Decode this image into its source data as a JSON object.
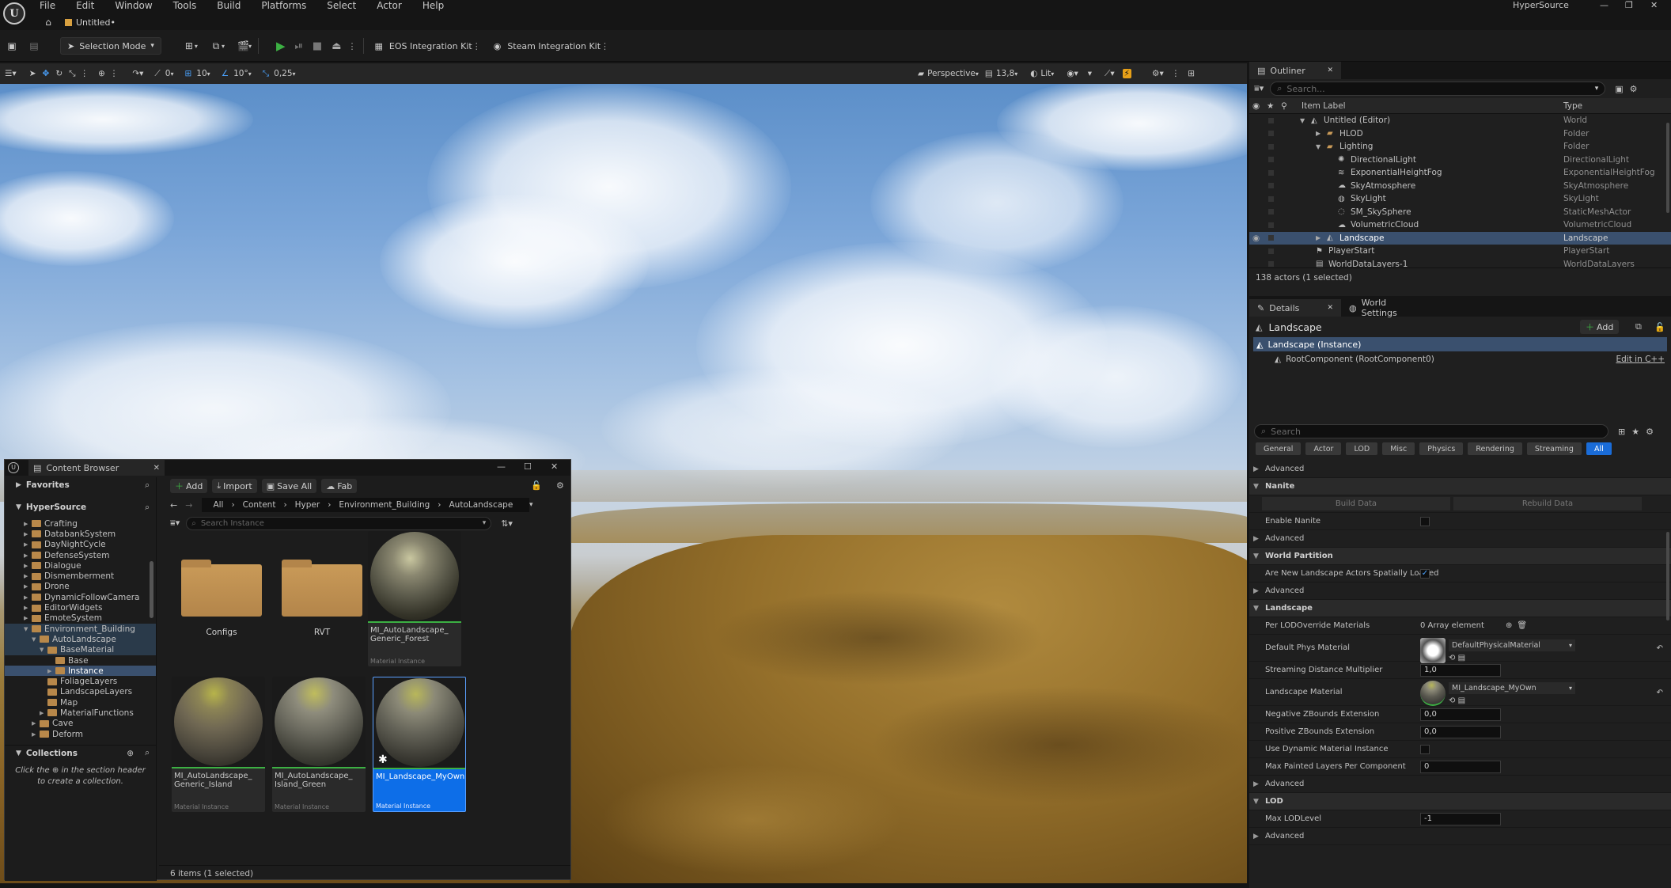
{
  "menubar": {
    "items": [
      "File",
      "Edit",
      "Window",
      "Tools",
      "Build",
      "Platforms",
      "Select",
      "Actor",
      "Help"
    ],
    "project_name": "HyperSource",
    "level_tab": "Untitled•"
  },
  "toolbar": {
    "selection_mode": "Selection Mode",
    "plugin1": "EOS Integration Kit",
    "plugin2": "Steam Integration Kit"
  },
  "viewport_toolbar": {
    "rot_snap": "0",
    "grid_snap": "10",
    "angle_snap": "10°",
    "scale_snap": "0,25",
    "perspective": "Perspective",
    "camera_speed": "13,8",
    "lit": "Lit"
  },
  "outliner": {
    "tab": "Outliner",
    "search_placeholder": "Search...",
    "col_label": "Item Label",
    "col_type": "Type",
    "rows": [
      {
        "label": "Untitled (Editor)",
        "type": "World"
      },
      {
        "label": "HLOD",
        "type": "Folder"
      },
      {
        "label": "Lighting",
        "type": "Folder"
      },
      {
        "label": "DirectionalLight",
        "type": "DirectionalLight"
      },
      {
        "label": "ExponentialHeightFog",
        "type": "ExponentialHeightFog"
      },
      {
        "label": "SkyAtmosphere",
        "type": "SkyAtmosphere"
      },
      {
        "label": "SkyLight",
        "type": "SkyLight"
      },
      {
        "label": "SM_SkySphere",
        "type": "StaticMeshActor"
      },
      {
        "label": "VolumetricCloud",
        "type": "VolumetricCloud"
      },
      {
        "label": "Landscape",
        "type": "Landscape"
      },
      {
        "label": "PlayerStart",
        "type": "PlayerStart"
      },
      {
        "label": "WorldDataLayers-1",
        "type": "WorldDataLayers"
      }
    ],
    "footer": "138 actors (1 selected)"
  },
  "details": {
    "tab_details": "Details",
    "tab_world": "World Settings",
    "actor_name": "Landscape",
    "add_label": "Add",
    "instance_label": "Landscape (Instance)",
    "root_component": "RootComponent (RootComponent0)",
    "edit_cpp": "Edit in C++",
    "search_placeholder": "Search",
    "filters": [
      "General",
      "Actor",
      "LOD",
      "Misc",
      "Physics",
      "Rendering",
      "Streaming",
      "All"
    ],
    "advanced": "Advanced",
    "nanite": "Nanite",
    "build_data": "Build Data",
    "rebuild_data": "Rebuild Data",
    "enable_nanite": "Enable Nanite",
    "world_partition": "World Partition",
    "spatially_loaded": "Are New Landscape Actors Spatially Loaded",
    "landscape_cat": "Landscape",
    "per_lod": "Per LODOverride Materials",
    "per_lod_val": "0 Array element",
    "default_phys": "Default Phys Material",
    "default_phys_val": "DefaultPhysicalMaterial",
    "streaming_dist": "Streaming Distance Multiplier",
    "streaming_dist_val": "1,0",
    "landscape_material": "Landscape Material",
    "landscape_material_val": "MI_Landscape_MyOwn",
    "neg_z": "Negative ZBounds Extension",
    "neg_z_val": "0,0",
    "pos_z": "Positive ZBounds Extension",
    "pos_z_val": "0,0",
    "use_dyn": "Use Dynamic Material Instance",
    "max_painted": "Max Painted Layers Per Component",
    "max_painted_val": "0",
    "lod_cat": "LOD",
    "max_lod": "Max LODLevel",
    "max_lod_val": "-1"
  },
  "content_browser": {
    "title": "Content Browser",
    "favorites": "Favorites",
    "root": "HyperSource",
    "add": "Add",
    "import": "Import",
    "save_all": "Save All",
    "fab": "Fab",
    "path": [
      "All",
      "Content",
      "Hyper",
      "Environment_Building",
      "AutoLandscape"
    ],
    "search_placeholder": "Search Instance",
    "tree": [
      {
        "label": "Crafting",
        "depth": 0
      },
      {
        "label": "DatabankSystem",
        "depth": 0
      },
      {
        "label": "DayNightCycle",
        "depth": 0
      },
      {
        "label": "DefenseSystem",
        "depth": 0
      },
      {
        "label": "Dialogue",
        "depth": 0
      },
      {
        "label": "Dismemberment",
        "depth": 0
      },
      {
        "label": "Drone",
        "depth": 0
      },
      {
        "label": "DynamicFollowCamera",
        "depth": 0
      },
      {
        "label": "EditorWidgets",
        "depth": 0
      },
      {
        "label": "EmoteSystem",
        "depth": 0
      },
      {
        "label": "Environment_Building",
        "depth": 0
      },
      {
        "label": "AutoLandscape",
        "depth": 1
      },
      {
        "label": "BaseMaterial",
        "depth": 2
      },
      {
        "label": "Base",
        "depth": 3
      },
      {
        "label": "Instance",
        "depth": 3
      },
      {
        "label": "FoliageLayers",
        "depth": 2
      },
      {
        "label": "LandscapeLayers",
        "depth": 2
      },
      {
        "label": "Map",
        "depth": 2
      },
      {
        "label": "MaterialFunctions",
        "depth": 2
      },
      {
        "label": "Cave",
        "depth": 1
      },
      {
        "label": "Deform",
        "depth": 1
      }
    ],
    "collections": "Collections",
    "collections_hint_a": "Click the",
    "collections_hint_b": "in the section header to create a collection.",
    "assets": [
      {
        "name": "Configs",
        "sub": ""
      },
      {
        "name": "RVT",
        "sub": ""
      },
      {
        "name": "MI_AutoLandscape_ Generic_Forest",
        "sub": "Material Instance"
      },
      {
        "name": "MI_AutoLandscape_ Generic_Island",
        "sub": "Material Instance"
      },
      {
        "name": "MI_AutoLandscape_ Island_Green",
        "sub": "Material Instance"
      },
      {
        "name": "MI_Landscape_MyOwn",
        "sub": "Material Instance"
      }
    ],
    "status": "6 items (1 selected)"
  },
  "colors": {
    "accent": "#1a6cd8",
    "selection": "#3a506e",
    "play_green": "#3cb043",
    "folder": "#b8884a"
  }
}
